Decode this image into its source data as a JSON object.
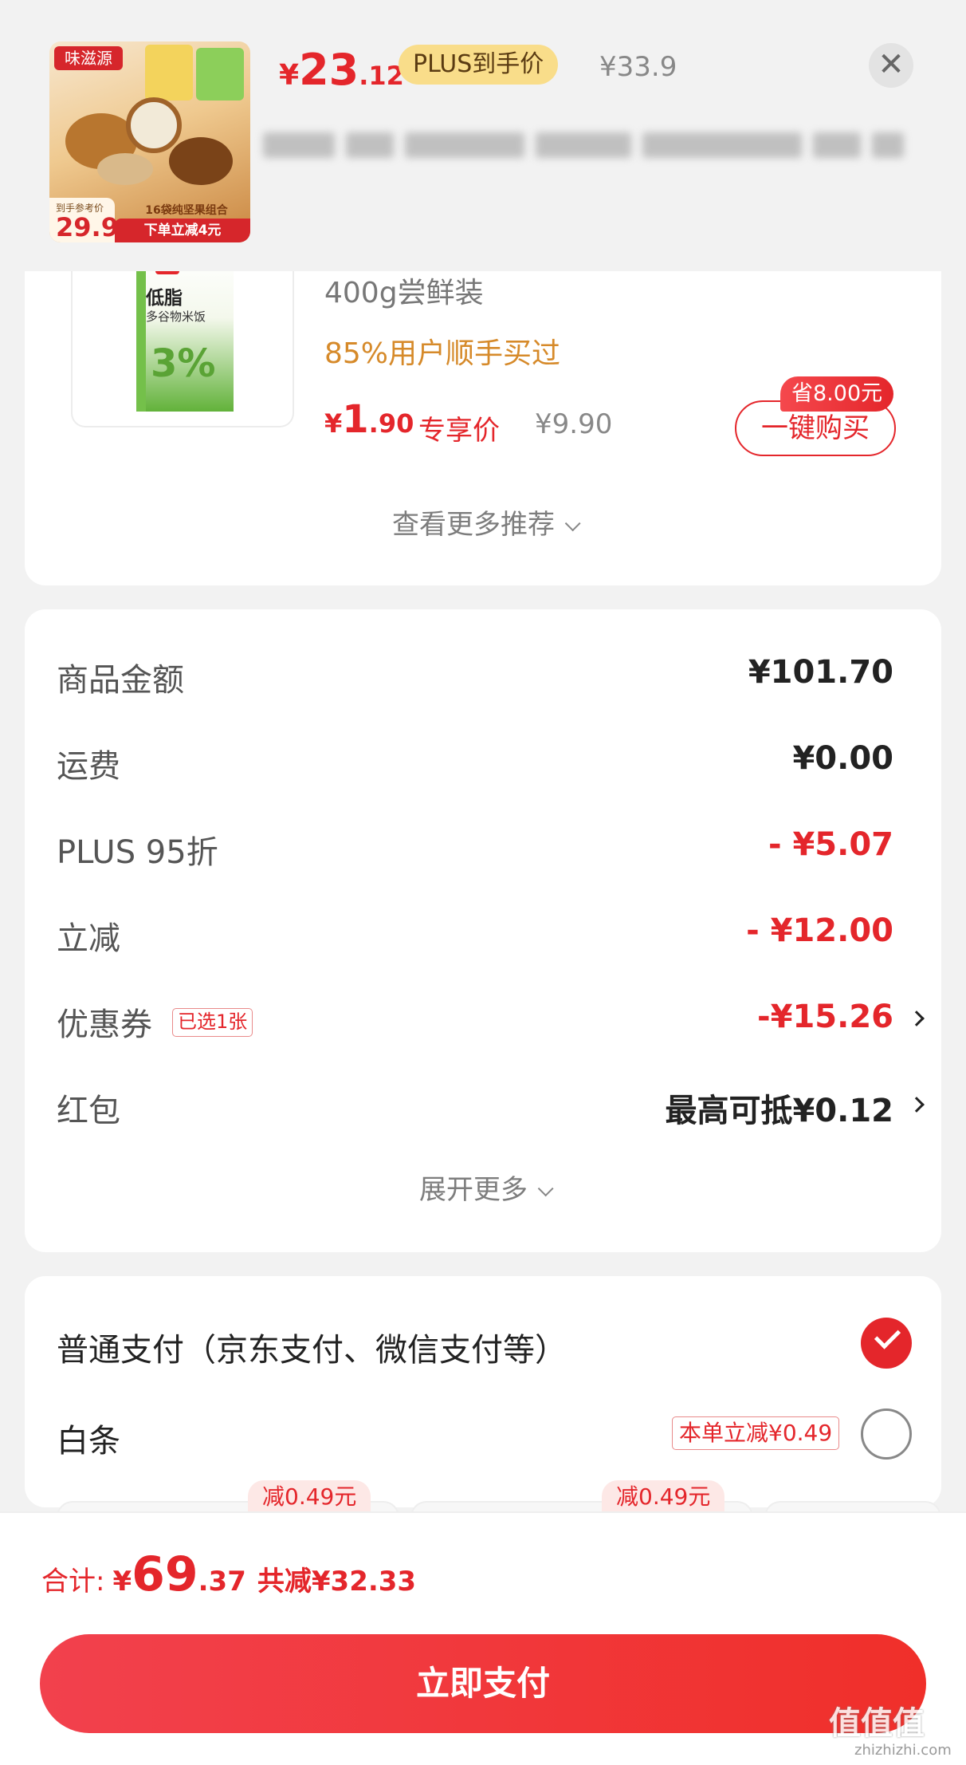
{
  "header": {
    "product_price": {
      "currency": "¥",
      "integer": "23",
      "decimal": ".12"
    },
    "plus_tag": "PLUS到手价",
    "original_price": "¥33.9",
    "close_symbol": "✕",
    "thumbnail": {
      "brand": "味滋源",
      "corner_label": "到手参考价",
      "corner_price": "29.9",
      "combo_text": "16袋纯坚果组合",
      "promo_text": "下单立减4元"
    }
  },
  "recommendation": {
    "image": {
      "title": "低脂",
      "subtitle": "多谷物米饭",
      "big": "3%"
    },
    "spec": "400g尝鲜装",
    "bought_text": "85%用户顺手买过",
    "price": {
      "currency": "¥",
      "integer": "1",
      "decimal": ".90"
    },
    "price_tag": "专享价",
    "original_price": "¥9.90",
    "save_badge": "省8.00元",
    "buy_button": "一键购买",
    "more_link": "查看更多推荐"
  },
  "summary": {
    "rows": [
      {
        "label": "商品金额",
        "value": "¥101.70"
      },
      {
        "label": "运费",
        "value": "¥0.00"
      },
      {
        "label": "PLUS 95折",
        "value": "- ¥5.07"
      },
      {
        "label": "立减",
        "value": "- ¥12.00"
      },
      {
        "label": "优惠券",
        "chip": "已选1张",
        "value": "-¥15.26"
      },
      {
        "label": "红包",
        "value": "最高可抵¥0.12"
      }
    ],
    "expand_link": "展开更多"
  },
  "payment": {
    "normal_label": "普通支付（京东支付、微信支付等）",
    "baitiao_label": "白条",
    "baitiao_tag": "本单立减¥0.49",
    "installments": [
      {
        "badge": "减0.49元"
      },
      {
        "badge": "减0.49元"
      }
    ]
  },
  "footer": {
    "total_label": "合计:",
    "total": {
      "currency": "¥",
      "integer": "69",
      "decimal": ".37"
    },
    "saved": "共减¥32.33",
    "pay_button": "立即支付"
  },
  "watermark": {
    "text": "值值值",
    "url": "zhizhizhi.com"
  },
  "colors": {
    "accent": "#e4262b",
    "plus_gold": "#f9dd8a",
    "orange": "#d68a2a"
  }
}
